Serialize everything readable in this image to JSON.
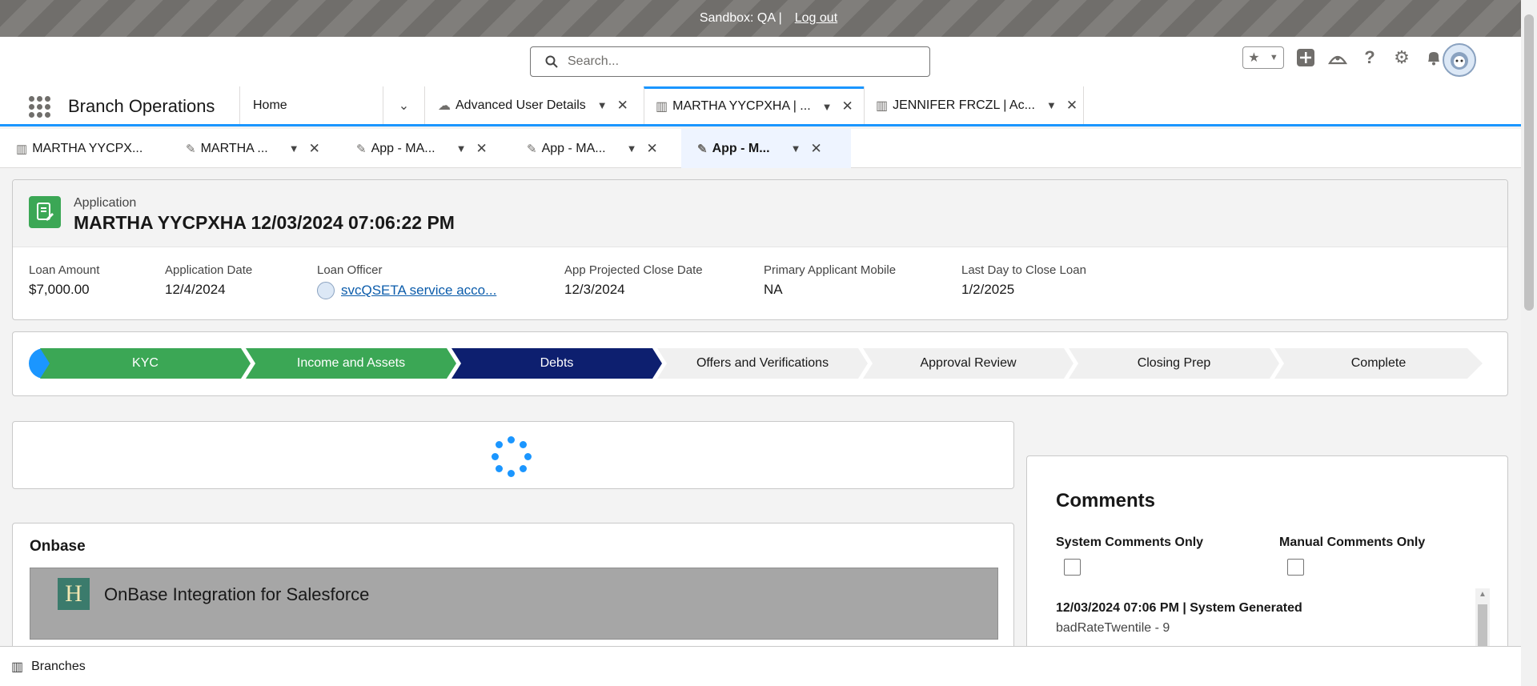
{
  "banner": {
    "sandbox": "Sandbox: QA |",
    "logout": "Log out"
  },
  "search": {
    "placeholder": "Search..."
  },
  "nav": {
    "app_name": "Branch Operations",
    "tabs": [
      {
        "label": "Home"
      },
      {
        "label": "Advanced User Details"
      },
      {
        "label": "MARTHA YYCPXHA | ..."
      },
      {
        "label": "JENNIFER FRCZL | Ac..."
      }
    ]
  },
  "subtabs": [
    {
      "label": "MARTHA YYCPX..."
    },
    {
      "label": "MARTHA ..."
    },
    {
      "label": "App - MA..."
    },
    {
      "label": "App - MA..."
    },
    {
      "label": "App - M..."
    }
  ],
  "record": {
    "type": "Application",
    "title": "MARTHA YYCPXHA 12/03/2024 07:06:22 PM",
    "fields": [
      {
        "label": "Loan Amount",
        "value": "$7,000.00"
      },
      {
        "label": "Application Date",
        "value": "12/4/2024"
      },
      {
        "label": "Loan Officer",
        "value": "svcQSETA service acco..."
      },
      {
        "label": "App Projected Close Date",
        "value": "12/3/2024"
      },
      {
        "label": "Primary Applicant Mobile",
        "value": "NA"
      },
      {
        "label": "Last Day to Close Loan",
        "value": "1/2/2025"
      }
    ]
  },
  "path": {
    "stages": [
      {
        "label": "KYC",
        "status": "complete"
      },
      {
        "label": "Income and Assets",
        "status": "complete"
      },
      {
        "label": "Debts",
        "status": "current"
      },
      {
        "label": "Offers and Verifications",
        "status": "incomplete"
      },
      {
        "label": "Approval Review",
        "status": "incomplete"
      },
      {
        "label": "Closing Prep",
        "status": "incomplete"
      },
      {
        "label": "Complete",
        "status": "incomplete"
      }
    ],
    "colors": {
      "complete": "#3ba755",
      "current": "#0d1f6f",
      "incomplete": "#f0f0f0"
    }
  },
  "onbase": {
    "title": "Onbase",
    "logo_letter": "H",
    "product_name": "OnBase Integration for Salesforce"
  },
  "comments": {
    "title": "Comments",
    "filter_system": "System Comments Only",
    "filter_manual": "Manual Comments Only",
    "entry_head": "12/03/2024 07:06 PM | System Generated",
    "entry_body": "badRateTwentile - 9"
  },
  "utility": {
    "label": "Branches"
  }
}
